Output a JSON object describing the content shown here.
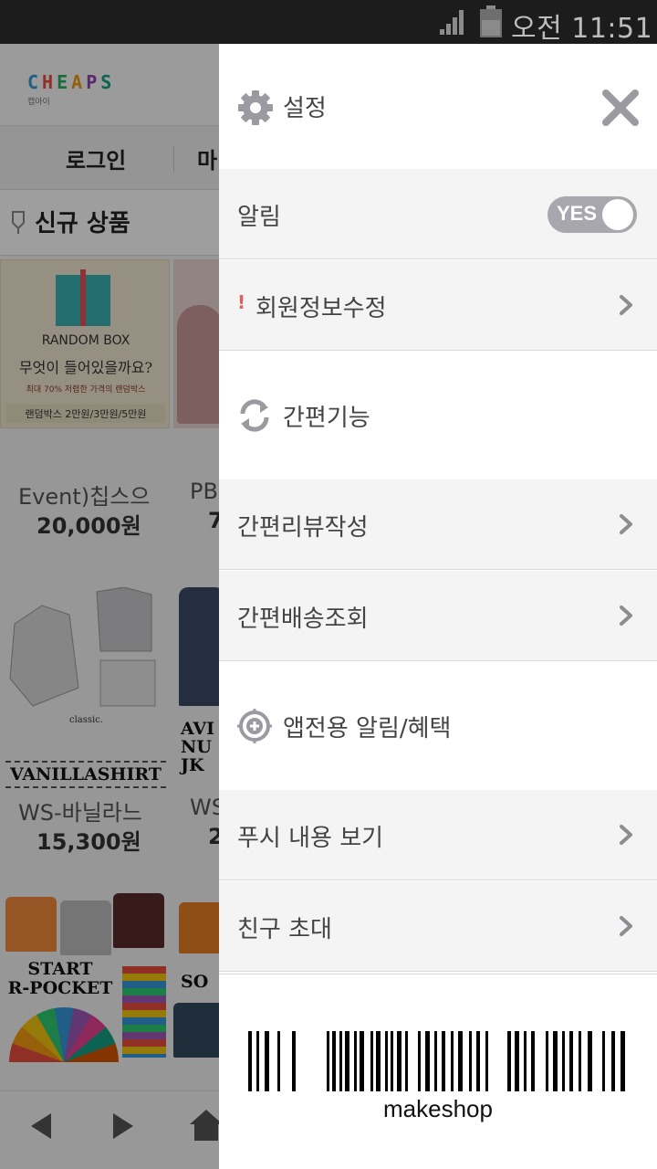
{
  "status_bar": {
    "time": "오전 11:51",
    "icons": [
      "signal-icon",
      "battery-icon"
    ]
  },
  "shop": {
    "logo": "CHEAPS",
    "logo_sub": "캡아이",
    "nav": {
      "login": "로그인",
      "my": "마"
    },
    "section_title": "신규 상품",
    "banner": {
      "line1": "RANDOM BOX",
      "line2": "무엇이 들어있을까요?",
      "line3": "최대 70% 저렴한 가격의 랜덤박스",
      "line4": "랜덤박스 2만원/3만원/5만원"
    },
    "products": [
      {
        "name": "Event)칩스으",
        "price": "20,000원"
      },
      {
        "name": "PB",
        "price": "7"
      },
      {
        "name": "WS-바닐라느",
        "price": "15,300원"
      },
      {
        "name": "WS",
        "price": "2"
      }
    ],
    "image_labels": {
      "classic": "classic.",
      "vanilla": "VANILLASHIRT",
      "jk": "AVI\nNU\nJK",
      "start": "START\nR-POCKET",
      "so": "SO"
    }
  },
  "drawer": {
    "title": "설정",
    "notification": {
      "label": "알림",
      "toggle_text": "YES",
      "enabled": true
    },
    "member_edit": {
      "label": "회원정보수정",
      "alert_mark": "!"
    },
    "quick_section": {
      "label": "간편기능"
    },
    "quick_review": {
      "label": "간편리뷰작성"
    },
    "quick_delivery": {
      "label": "간편배송조회"
    },
    "app_section": {
      "label": "앱전용 알림/혜택"
    },
    "push_view": {
      "label": "푸시 내용 보기"
    },
    "invite": {
      "label": "친구 초대"
    },
    "barcode_text": "makeshop"
  },
  "colors": {
    "status_bar_bg": "#1c1c1c",
    "drawer_row_bg": "#f4f4f4",
    "icon_gray": "#9a9aa0",
    "toggle_bg": "#a7a7ad",
    "alert_red": "#e06060"
  }
}
